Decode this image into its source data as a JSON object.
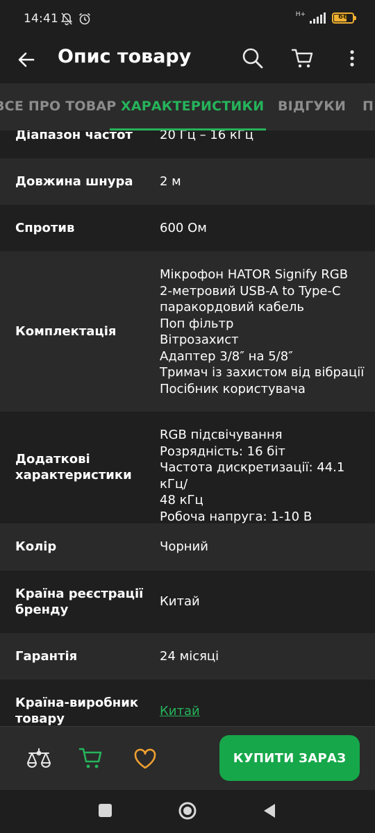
{
  "status": {
    "time": "14:41",
    "network": "H+",
    "battery_level": "66"
  },
  "app_bar": {
    "title": "Опис товару"
  },
  "tabs": [
    {
      "label": "ВСЕ ПРО ТОВАР"
    },
    {
      "label": "ХАРАКТЕРИСТИКИ"
    },
    {
      "label": "ВІДГУКИ"
    },
    {
      "label": "П"
    }
  ],
  "specs": [
    {
      "label": "Діапазон частот",
      "value": "20 Гц – 16 кГц"
    },
    {
      "label": "Довжина шнура",
      "value": "2 м"
    },
    {
      "label": "Спротив",
      "value": "600 Ом"
    },
    {
      "label": "Комплектація",
      "lines": [
        "Мікрофон HATOR Signify RGB",
        "2-метровий USB-A to Type-C",
        "паракордовий кабель",
        "Поп фільтр",
        "Вітрозахист",
        "Адаптер 3/8″ на 5/8″",
        "Тримач із захистом від вібрації",
        "Посібник користувача"
      ]
    },
    {
      "label_lines": [
        "Додаткові",
        "характеристики"
      ],
      "lines": [
        "RGB підсвічування",
        "Розрядність: 16 біт",
        "Частота дискретизації: 44.1 кГц/",
        "48 кГц",
        "Робоча напруга: 1-10 В"
      ]
    },
    {
      "label": "Колір",
      "value": "Чорний"
    },
    {
      "label_lines": [
        "Країна реєстрації",
        "бренду"
      ],
      "value": "Китай"
    },
    {
      "label": "Гарантія",
      "value": "24 місяці"
    },
    {
      "label_lines": [
        "Країна-виробник",
        "товару"
      ],
      "value": "Китай"
    }
  ],
  "bottom_bar": {
    "buy_label": "КУПИТИ ЗАРАЗ"
  },
  "colors": {
    "accent": "#26b35b",
    "button": "#16a74a",
    "heart": "#f0a030",
    "battery": "#f0b030"
  }
}
